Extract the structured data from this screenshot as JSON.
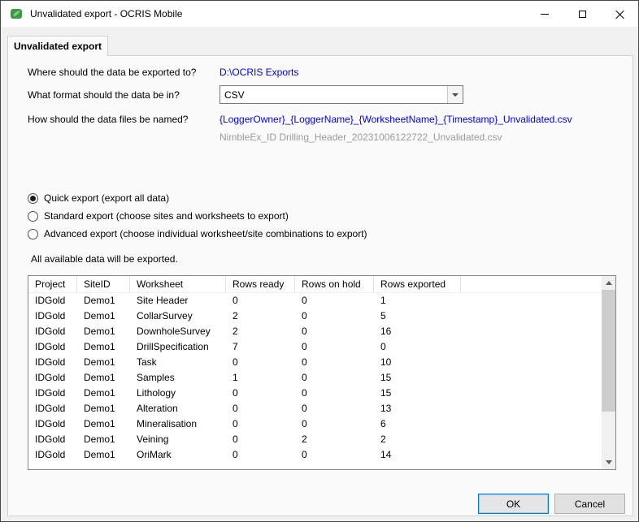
{
  "window": {
    "title": "Unvalidated export - OCRIS Mobile"
  },
  "tab": {
    "label": "Unvalidated export"
  },
  "form": {
    "export_to_label": "Where should the data be exported to?",
    "export_to_value": "D:\\OCRIS Exports",
    "format_label": "What format should the data be in?",
    "format_value": "CSV",
    "naming_label": "How should the data files be named?",
    "naming_value": "{LoggerOwner}_{LoggerName}_{WorksheetName}_{Timestamp}_Unvalidated.csv",
    "naming_example": "NimbleEx_ID Drilling_Header_20231006122722_Unvalidated.csv"
  },
  "options": [
    {
      "label": "Quick export (export all data)",
      "selected": true
    },
    {
      "label": "Standard export (choose sites and worksheets to export)",
      "selected": false
    },
    {
      "label": "Advanced export (choose individual worksheet/site combinations to export)",
      "selected": false
    }
  ],
  "info_text": "All available data will be exported.",
  "table": {
    "columns": [
      "Project",
      "SiteID",
      "Worksheet",
      "Rows ready",
      "Rows on hold",
      "Rows exported"
    ],
    "rows": [
      [
        "IDGold",
        "Demo1",
        "Site Header",
        "0",
        "0",
        "1"
      ],
      [
        "IDGold",
        "Demo1",
        "CollarSurvey",
        "2",
        "0",
        "5"
      ],
      [
        "IDGold",
        "Demo1",
        "DownholeSurvey",
        "2",
        "0",
        "16"
      ],
      [
        "IDGold",
        "Demo1",
        "DrillSpecification",
        "7",
        "0",
        "0"
      ],
      [
        "IDGold",
        "Demo1",
        "Task",
        "0",
        "0",
        "10"
      ],
      [
        "IDGold",
        "Demo1",
        "Samples",
        "1",
        "0",
        "15"
      ],
      [
        "IDGold",
        "Demo1",
        "Lithology",
        "0",
        "0",
        "15"
      ],
      [
        "IDGold",
        "Demo1",
        "Alteration",
        "0",
        "0",
        "13"
      ],
      [
        "IDGold",
        "Demo1",
        "Mineralisation",
        "0",
        "0",
        "6"
      ],
      [
        "IDGold",
        "Demo1",
        "Veining",
        "0",
        "2",
        "2"
      ],
      [
        "IDGold",
        "Demo1",
        "OriMark",
        "0",
        "0",
        "14"
      ]
    ]
  },
  "buttons": {
    "ok": "OK",
    "cancel": "Cancel"
  },
  "colors": {
    "link_text": "#0000ee",
    "muted_text": "#9b9b9b",
    "focus_border": "#0078d7",
    "app_icon_green": "#3d9942"
  }
}
